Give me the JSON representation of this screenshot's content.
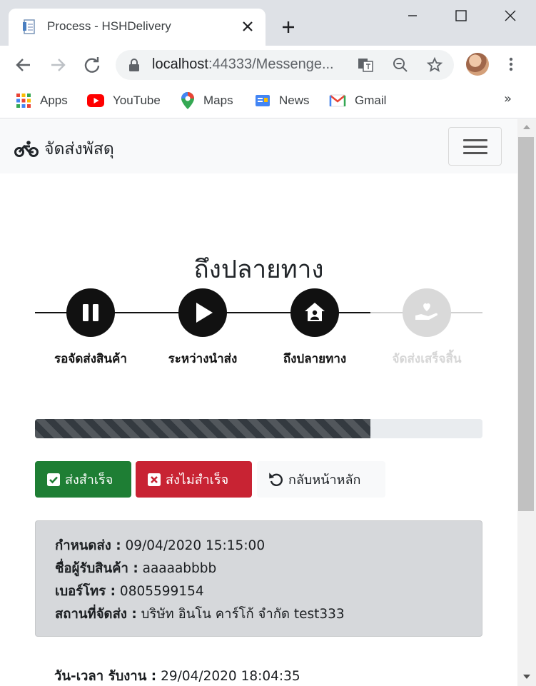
{
  "browser": {
    "tab_title": "Process - HSHDelivery",
    "url_host": "localhost",
    "url_rest": ":44333/Messenge...",
    "bookmarks": [
      {
        "label": "Apps",
        "icon": "apps-grid-icon"
      },
      {
        "label": "YouTube",
        "icon": "youtube-icon"
      },
      {
        "label": "Maps",
        "icon": "maps-pin-icon"
      },
      {
        "label": "News",
        "icon": "news-icon"
      },
      {
        "label": "Gmail",
        "icon": "gmail-icon"
      }
    ],
    "more_bookmarks": "»"
  },
  "navbar": {
    "brand": "จัดส่งพัสดุ"
  },
  "status": {
    "title": "ถึงปลายทาง"
  },
  "steps": [
    {
      "label": "รอจัดส่งสินค้า",
      "state": "done",
      "icon": "pause-icon"
    },
    {
      "label": "ระหว่างนำส่ง",
      "state": "done",
      "icon": "play-icon"
    },
    {
      "label": "ถึงปลายทาง",
      "state": "current",
      "icon": "house-user-icon"
    },
    {
      "label": "จัดส่งเสร็จสิ้น",
      "state": "pending",
      "icon": "hand-heart-icon"
    }
  ],
  "progress": {
    "value": 0.75
  },
  "buttons": {
    "success": "ส่งสำเร็จ",
    "fail": "ส่งไม่สำเร็จ",
    "home": "กลับหน้าหลัก"
  },
  "details": {
    "deadline_label": "กำหนดส่ง :",
    "deadline_value": "09/04/2020 15:15:00",
    "recipient_label": "ชื่อผู้รับสินค้า :",
    "recipient_value": "aaaaabbbb",
    "phone_label": "เบอร์โทร :",
    "phone_value": "0805599154",
    "place_label": "สถานที่จัดส่ง :",
    "place_value": "บริษัท อินโน คาร์โก้ จำกัด test333"
  },
  "accepted": {
    "label": "วัน-เวลา รับงาน :",
    "value": "29/04/2020 18:04:35"
  },
  "colors": {
    "success": "#1e7e34",
    "danger": "#c82333",
    "step_active": "#111111",
    "step_pending": "#d9d9d9",
    "card_bg": "#d6d8db"
  }
}
